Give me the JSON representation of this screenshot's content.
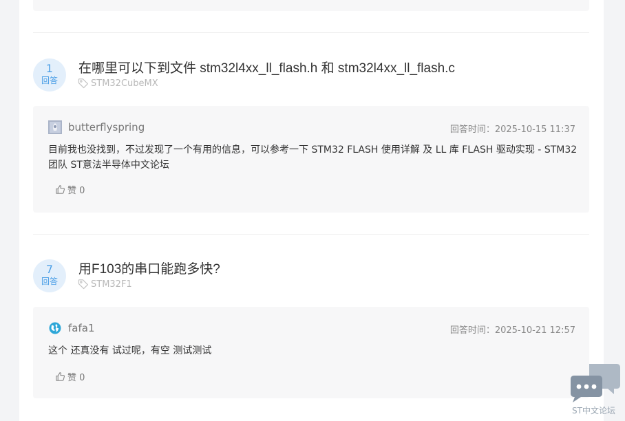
{
  "questions": [
    {
      "answer_count": "1",
      "answer_label": "回答",
      "title": "在哪里可以下到文件 stm32l4xx_ll_flash.h 和 stm32l4xx_ll_flash.c",
      "tag": "STM32CubeMX",
      "answer": {
        "author": "butterflyspring",
        "time": "回答时间：2025-10-15 11:37",
        "body": "目前我也没找到，不过发现了一个有用的信息，可以参考一下 STM32 FLASH 使用详解 及 LL 库 FLASH 驱动实现 - STM32团队 ST意法半导体中文论坛",
        "likes": "赞 0"
      }
    },
    {
      "answer_count": "7",
      "answer_label": "回答",
      "title": "用F103的串口能跑多快?",
      "tag": "STM32F1",
      "answer": {
        "author": "fafa1",
        "time": "回答时间：2025-10-21 12:57",
        "body": "这个 还真没有 试过呢，有空 测试测试",
        "likes": "赞 0"
      }
    }
  ],
  "chat_widget": {
    "label": "ST中文论坛"
  },
  "colors": {
    "accent": "#4a9ee6",
    "badge_bg": "#e3effb",
    "card_bg": "#f7f7f8"
  }
}
